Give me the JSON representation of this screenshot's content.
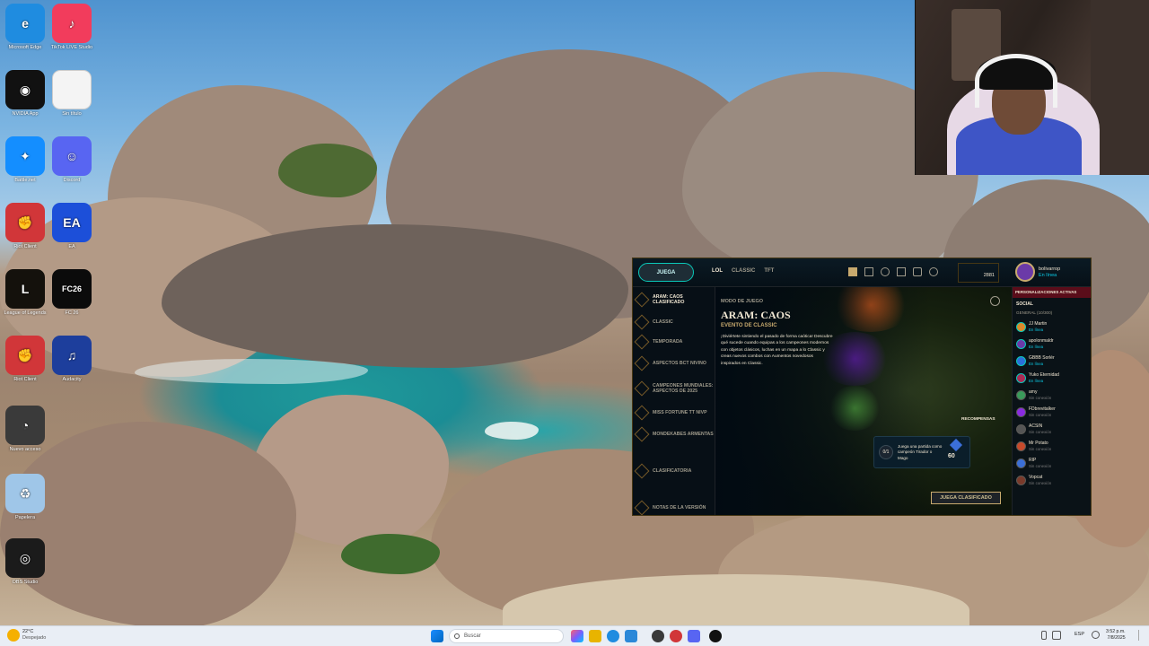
{
  "desktop_icons": [
    {
      "label": "Microsoft Edge",
      "name": "edge-icon",
      "color": "#1f8ce0",
      "glyph": "e"
    },
    {
      "label": "TikTok LIVE Studio",
      "name": "tiktok-live-icon",
      "color": "#f23c5c",
      "glyph": "♪"
    },
    {
      "label": "NVIDIA App",
      "name": "nvidia-icon",
      "color": "#111111",
      "glyph": "◉"
    },
    {
      "label": "Sin título",
      "name": "blank-file-icon",
      "color": "#f4f4f4",
      "glyph": ""
    },
    {
      "label": "Battle.net",
      "name": "battlenet-icon",
      "color": "#148eff",
      "glyph": "✦"
    },
    {
      "label": "Discord",
      "name": "discord-icon",
      "color": "#5865f2",
      "glyph": "☺"
    },
    {
      "label": "Riot Client",
      "name": "riot-client-icon",
      "color": "#d13639",
      "glyph": "✊"
    },
    {
      "label": "EA",
      "name": "ea-icon",
      "color": "#1c4fd9",
      "glyph": "EA"
    },
    {
      "label": "League of Legends",
      "name": "league-icon",
      "color": "#14110c",
      "glyph": "L"
    },
    {
      "label": "FC 26",
      "name": "fc26-icon",
      "color": "#0b0b0b",
      "glyph": "FC26"
    },
    {
      "label": "Riot Client",
      "name": "riot-client-2-icon",
      "color": "#d13639",
      "glyph": "✊"
    },
    {
      "label": "Audacity",
      "name": "audacity-icon",
      "color": "#1d3e9c",
      "glyph": "♫"
    },
    {
      "label": "Nuevo acceso",
      "name": "shortcut-icon",
      "color": "#3a3a3a",
      "glyph": "◔"
    },
    {
      "label": "Papelera",
      "name": "recycle-bin-icon",
      "color": "#9fc6e8",
      "glyph": "♻"
    },
    {
      "label": "OBS Studio",
      "name": "obs-icon",
      "color": "#1b1b1b",
      "glyph": "◎"
    }
  ],
  "lol": {
    "play_button": "JUEGA",
    "tabs": [
      "LOL",
      "CLASSIC",
      "TFT"
    ],
    "currency": "2881",
    "profile": {
      "name": "bolivarrop",
      "status": "En línea"
    },
    "sidebar": [
      "ARAM: CAOS CLASIFICADO",
      "CLASSIC",
      "TEMPORADA",
      "ASPECTOS BCT NIVINO",
      "CAMPEONES MUNDIALES: ASPECTOS DE 2025",
      "MISS FORTUNE TT NIVP",
      "MONDEKABES ARMENTAS",
      "CLASIFICATORIA",
      "NOTAS DE LA VERSIÓN"
    ],
    "main": {
      "mode_label": "MODO DE JUEGO",
      "title": "ARAM: CAOS",
      "subtitle": "EVENTO DE CLASSIC",
      "description": "¡Diviértete sintiendo el pasado de forma caótica! Descubre qué sucede cuando equipas a los campeones modernos con objetos clásicos, luchas en un mapa a lo Classic y creas nuevos combos con Aumentos novedosos inspirados en Classic.",
      "rewards_label": "RECOMPENSAS",
      "mission_progress": "0/1",
      "mission_text": "Juega una partida como campeón Tirador o Mago",
      "mission_reward": "60",
      "cta_button": "JUEGA CLASIFICADO"
    },
    "social": {
      "banner": "PERSONALIZACIONES ACTIVAS",
      "social_label": "SOCIAL",
      "group": "GENERAL (10/300)",
      "friends": [
        {
          "name": "JJ Martin",
          "status": "En línea"
        },
        {
          "name": "apolonmaldr",
          "status": "En línea"
        },
        {
          "name": "GBBB Sorlér",
          "status": "En línea"
        },
        {
          "name": "Yuko Eternidad",
          "status": "En línea"
        },
        {
          "name": "amy",
          "status": "Sin conexión"
        },
        {
          "name": "FDbrevitalker",
          "status": "Sin conexión"
        },
        {
          "name": "ACSIN",
          "status": "Sin conexión"
        },
        {
          "name": "Mr Potato",
          "status": "Sin conexión"
        },
        {
          "name": "RIP",
          "status": "Sin conexión"
        },
        {
          "name": "Vopcat",
          "status": "Sin conexión"
        }
      ]
    }
  },
  "taskbar": {
    "weather_temp": "22°C",
    "weather_desc": "Despejado",
    "search_placeholder": "Buscar",
    "lang": "ESP",
    "time": "3:52 p.m.",
    "date": "7/8/2025"
  }
}
